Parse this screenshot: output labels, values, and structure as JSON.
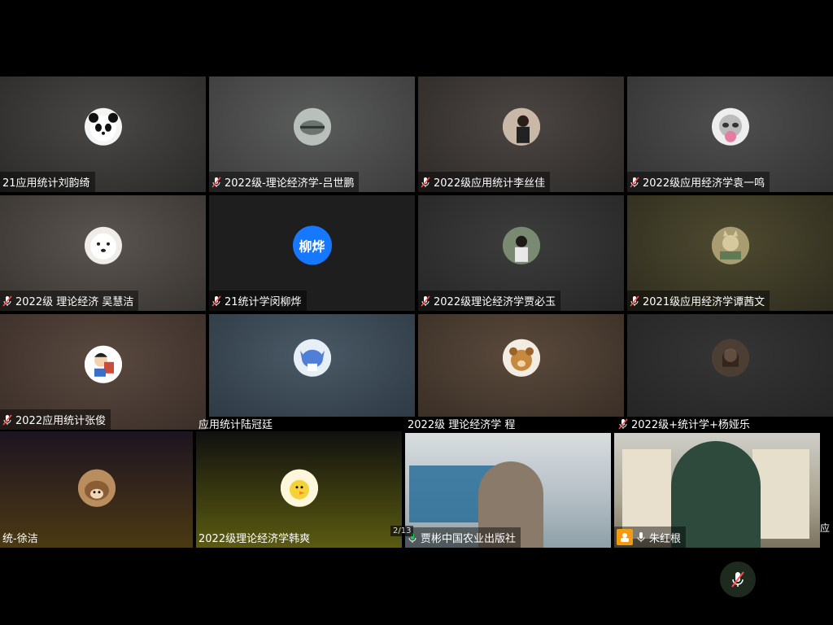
{
  "page_indicator": "2/13",
  "side_label": "应",
  "colors": {
    "muted_mic": "#ff4d4f",
    "active_border": "#1f9d43",
    "host_badge": "#f29a12",
    "avatar_blue": "#1677ff"
  },
  "participants": [
    {
      "label": "21应用统计刘韵绮",
      "avatar_icon": "panda-icon",
      "muted": false
    },
    {
      "label": "2022级-理论经济学-吕世鹏",
      "avatar_icon": "bird-photo-icon",
      "muted": true
    },
    {
      "label": "2022级应用统计李丝佳",
      "avatar_icon": "person-photo-icon",
      "muted": true
    },
    {
      "label": "2022级应用经济学袁一鸣",
      "avatar_icon": "raccoon-icon",
      "muted": true
    },
    {
      "label": "2022级 理论经济 吴慧洁",
      "avatar_icon": "dog-icon",
      "muted": true
    },
    {
      "label": "21统计学闵柳烨",
      "avatar_text": "柳烨",
      "muted": true
    },
    {
      "label": "2022级理论经济学贾必玉",
      "avatar_icon": "person-photo-icon",
      "muted": true
    },
    {
      "label": "2021级应用经济学谭茜文",
      "avatar_icon": "cat-icon",
      "muted": true
    },
    {
      "label": "2022应用统计张俊",
      "avatar_icon": "cartoon-boy-icon",
      "muted": true
    },
    {
      "label": "应用统计陆冠廷",
      "avatar_icon": "stitch-icon",
      "muted": false
    },
    {
      "label": "2022级 理论经济学 程",
      "avatar_icon": "bear-dog-icon",
      "muted": false
    },
    {
      "label": "2022级+统计学+杨娅乐",
      "avatar_icon": "girl-photo-icon",
      "muted": true
    },
    {
      "label": "统-徐洁",
      "avatar_icon": "hedgehog-icon",
      "muted": false
    },
    {
      "label": "2022级理论经济学韩爽",
      "avatar_icon": "duck-icon",
      "muted": false
    },
    {
      "label": "贾彬中国农业出版社",
      "video": true,
      "active": true,
      "mic_on": true
    },
    {
      "label": "朱红根",
      "video": true,
      "host": true,
      "mic_on": true
    }
  ],
  "bottom": {
    "mic_button": "muted-mic-icon"
  }
}
